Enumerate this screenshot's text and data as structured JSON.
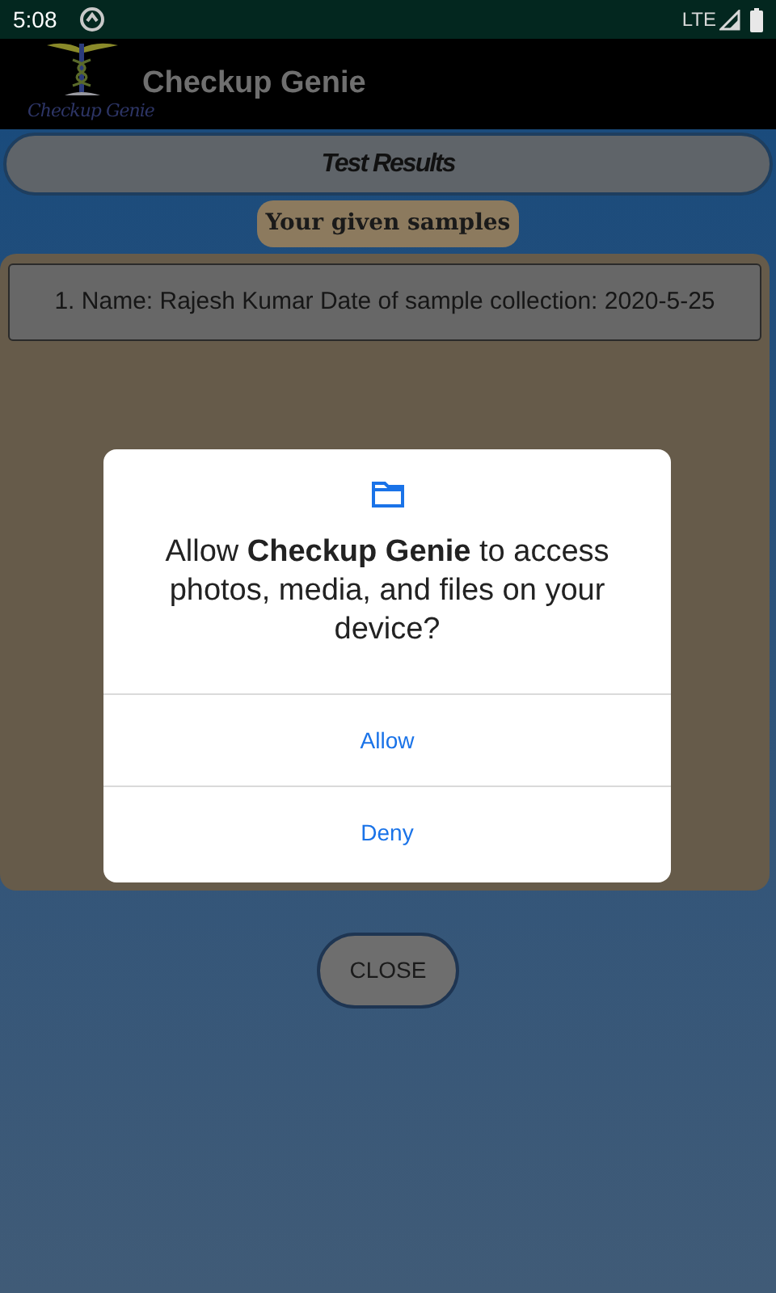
{
  "status_bar": {
    "time": "5:08",
    "network": "LTE"
  },
  "app_bar": {
    "logo_text": "Checkup Genie",
    "title": "Checkup Genie"
  },
  "header": {
    "title": "Test Results"
  },
  "section_label": "Your given samples",
  "samples": [
    {
      "text": "1. Name: Rajesh Kumar Date of sample collection: 2020-5-25"
    }
  ],
  "close_button": "CLOSE",
  "dialog": {
    "message": "Allow **Checkup Genie** to access photos, media, and files on your device?",
    "buttons": [
      {
        "label": "Allow"
      },
      {
        "label": "Deny"
      }
    ]
  }
}
